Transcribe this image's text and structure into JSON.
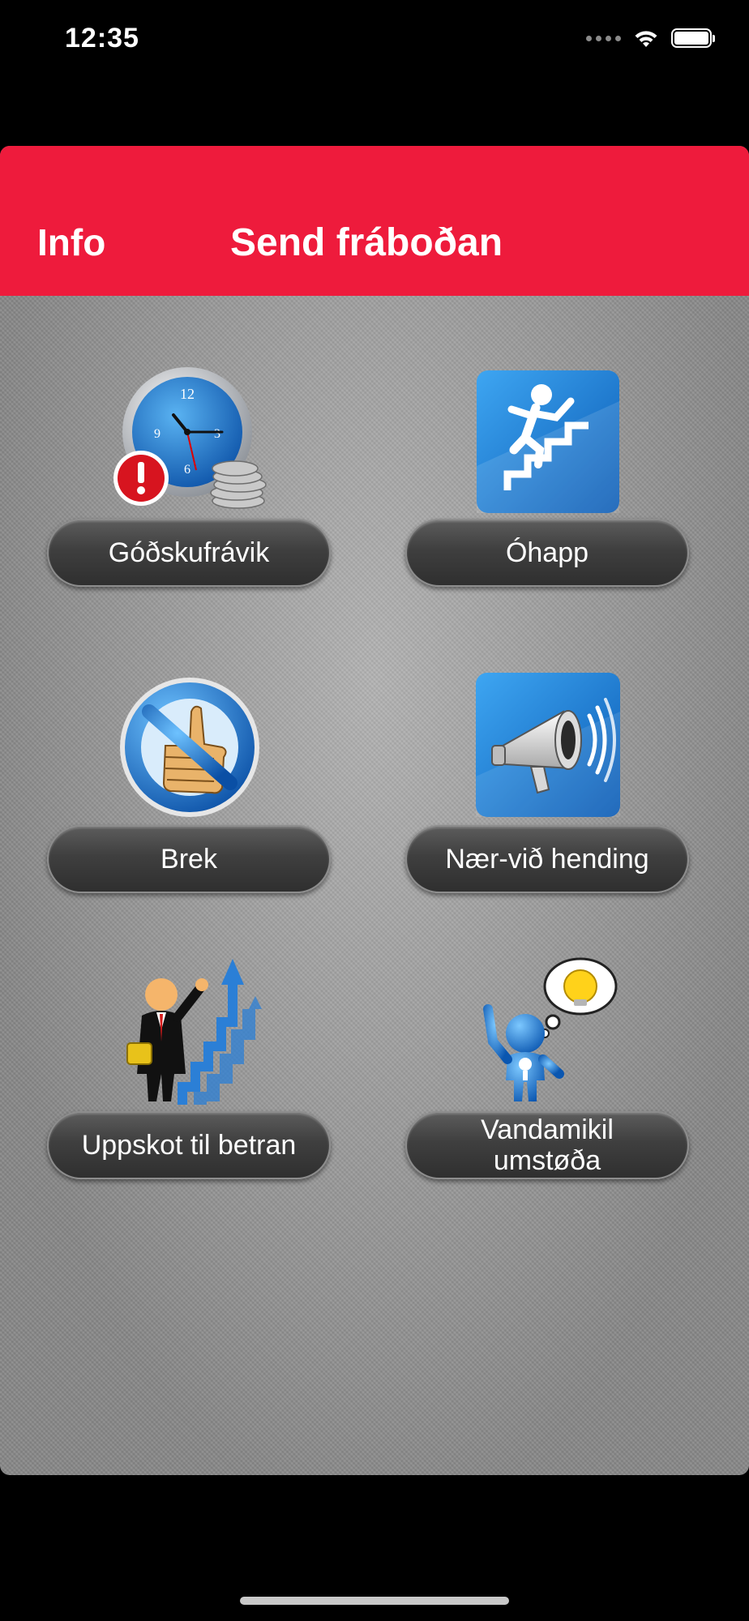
{
  "status_bar": {
    "time": "12:35",
    "icons": [
      "cellular-signal-icon",
      "wifi-icon",
      "battery-icon"
    ]
  },
  "nav_bar": {
    "left_button": "Info",
    "title": "Send fráboðan",
    "color": "#ee1b3c"
  },
  "tiles": [
    {
      "label": "Góðskufrávik",
      "icon": "clock-coins-warning-icon"
    },
    {
      "label": "Óhapp",
      "icon": "falling-person-stairs-icon"
    },
    {
      "label": "Brek",
      "icon": "no-thumbs-up-icon"
    },
    {
      "label": "Nær-við hending",
      "icon": "megaphone-icon"
    },
    {
      "label": "Uppskot til betran",
      "icon": "businessman-arrows-icon"
    },
    {
      "label": "Vandamikil\numstøða",
      "icon": "thinking-figure-lightbulb-icon"
    }
  ]
}
